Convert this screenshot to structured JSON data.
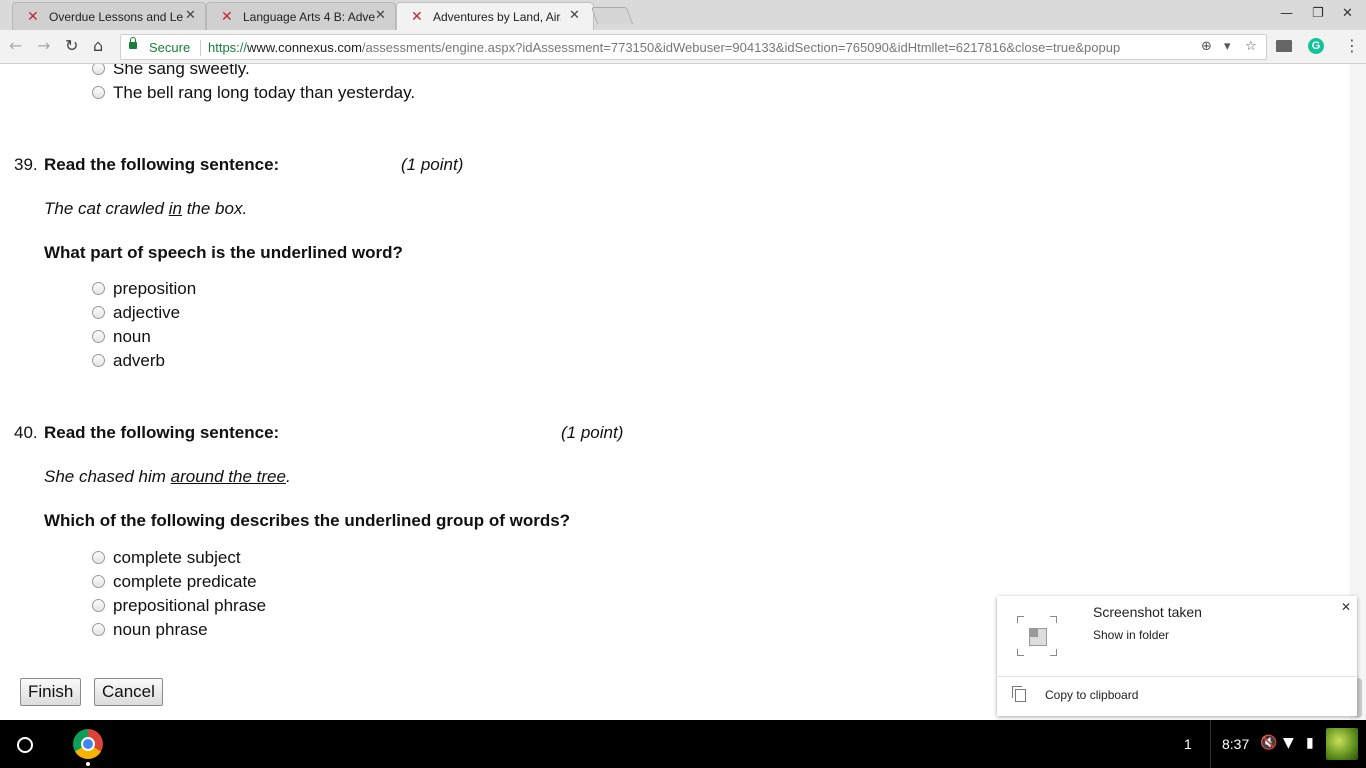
{
  "browser": {
    "tabs": [
      {
        "title": "Overdue Lessons and Le",
        "close": "✕"
      },
      {
        "title": "Language Arts 4 B: Adve",
        "close": "✕"
      },
      {
        "title": "Adventures by Land, Air,",
        "close": "✕"
      }
    ],
    "window_controls": {
      "minimize": "—",
      "restore": "❐",
      "close": "✕"
    },
    "nav": {
      "back": "←",
      "forward": "→",
      "reload": "↻",
      "home": "⌂"
    },
    "omnibox": {
      "secure_label": "Secure",
      "url_scheme": "https://",
      "url_host": "www.connexus.com",
      "url_path": "/assessments/engine.aspx?idAssessment=773150&idWebuser=904133&idSection=765090&idHtmllet=6217816&close=true&popup"
    },
    "omni_icons": {
      "zoom": "⊕",
      "bookmark": "☆"
    },
    "extensions": {
      "grammarly": "G",
      "menu": "⋮"
    }
  },
  "quiz": {
    "prev_options": [
      "She sang sweetly.",
      "The bell rang long today than yesterday."
    ],
    "q39": {
      "number": "39.",
      "heading": "Read the following sentence:",
      "points": "(1 point)",
      "sentence_before": "The cat crawled ",
      "sentence_underlined": "in",
      "sentence_after": " the box.",
      "prompt": "What part of speech is the underlined word?",
      "options": [
        "preposition",
        "adjective",
        "noun",
        "adverb"
      ]
    },
    "q40": {
      "number": "40.",
      "heading": "Read the following sentence:",
      "points": "(1 point)",
      "sentence_before": "She chased him ",
      "sentence_underlined": "around the tree",
      "sentence_after": ".",
      "prompt": "Which of the following describes the underlined group of words?",
      "options": [
        "complete subject",
        "complete predicate",
        "prepositional phrase",
        "noun phrase"
      ]
    },
    "buttons": {
      "finish": "Finish",
      "cancel": "Cancel"
    }
  },
  "notification": {
    "title": "Screenshot taken",
    "action": "Show in folder",
    "copy": "Copy to clipboard",
    "close": "✕"
  },
  "taskbar": {
    "notification_count": "1",
    "clock": "8:37"
  }
}
